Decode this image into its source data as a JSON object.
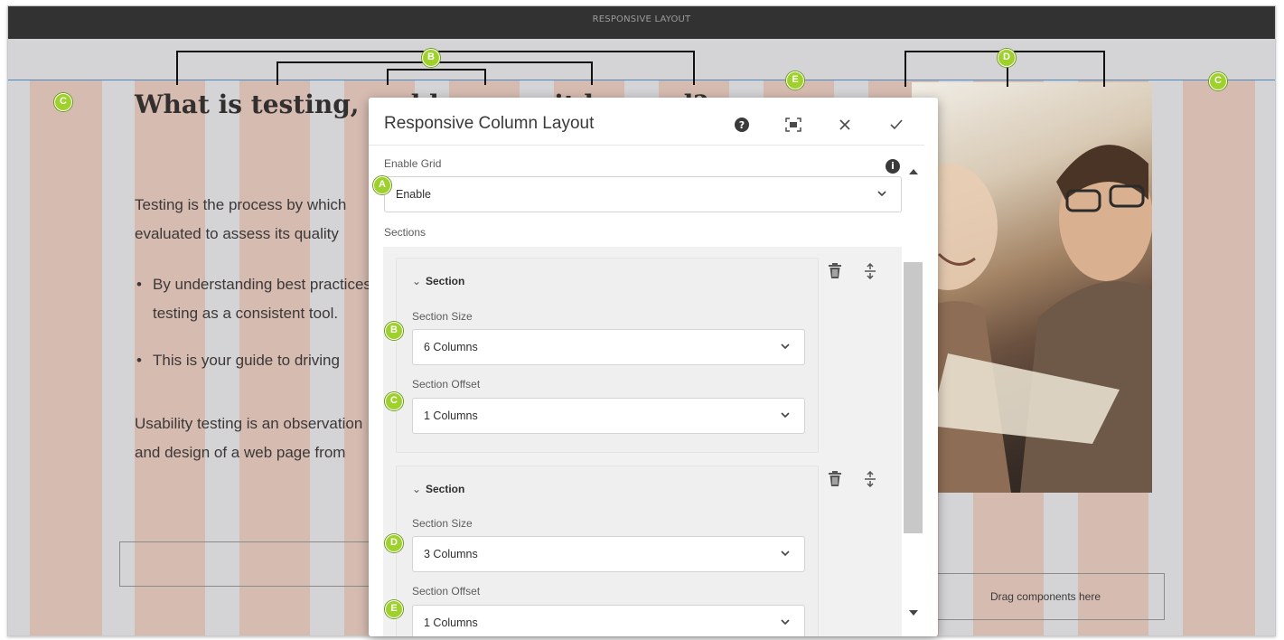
{
  "topbar": {
    "title": "RESPONSIVE LAYOUT"
  },
  "page": {
    "heading": "What is testing, and how can it be used?",
    "paragraph1": "Testing is the process by which",
    "paragraph1b": "evaluated to assess its quality",
    "bullets": [
      {
        "line1": "By understanding best practices",
        "line2": "testing as a consistent tool."
      },
      {
        "line1": "This is your guide to driving"
      }
    ],
    "paragraph2": "Usability testing is an observation",
    "paragraph2b": "and design of a web page from",
    "dropzone_label": "Drag components here"
  },
  "callouts": {
    "a": "A",
    "b": "B",
    "c": "C",
    "d": "D",
    "e": "E"
  },
  "dialog": {
    "title": "Responsive Column Layout",
    "actions": {
      "help": "help-icon",
      "fullscreen": "fullscreen-icon",
      "close": "close-icon",
      "done": "check-icon"
    },
    "enable_grid": {
      "label": "Enable Grid",
      "value": "Enable"
    },
    "sections_label": "Sections",
    "sections": [
      {
        "header": "Section",
        "size_label": "Section Size",
        "size_value": "6 Columns",
        "offset_label": "Section Offset",
        "offset_value": "1 Columns"
      },
      {
        "header": "Section",
        "size_label": "Section Size",
        "size_value": "3 Columns",
        "offset_label": "Section Offset",
        "offset_value": "1 Columns"
      }
    ]
  },
  "colors": {
    "column": "#d6b8ac",
    "callout": "#9ed12c",
    "topbar": "#323232",
    "grid_line": "#4e86c0"
  }
}
